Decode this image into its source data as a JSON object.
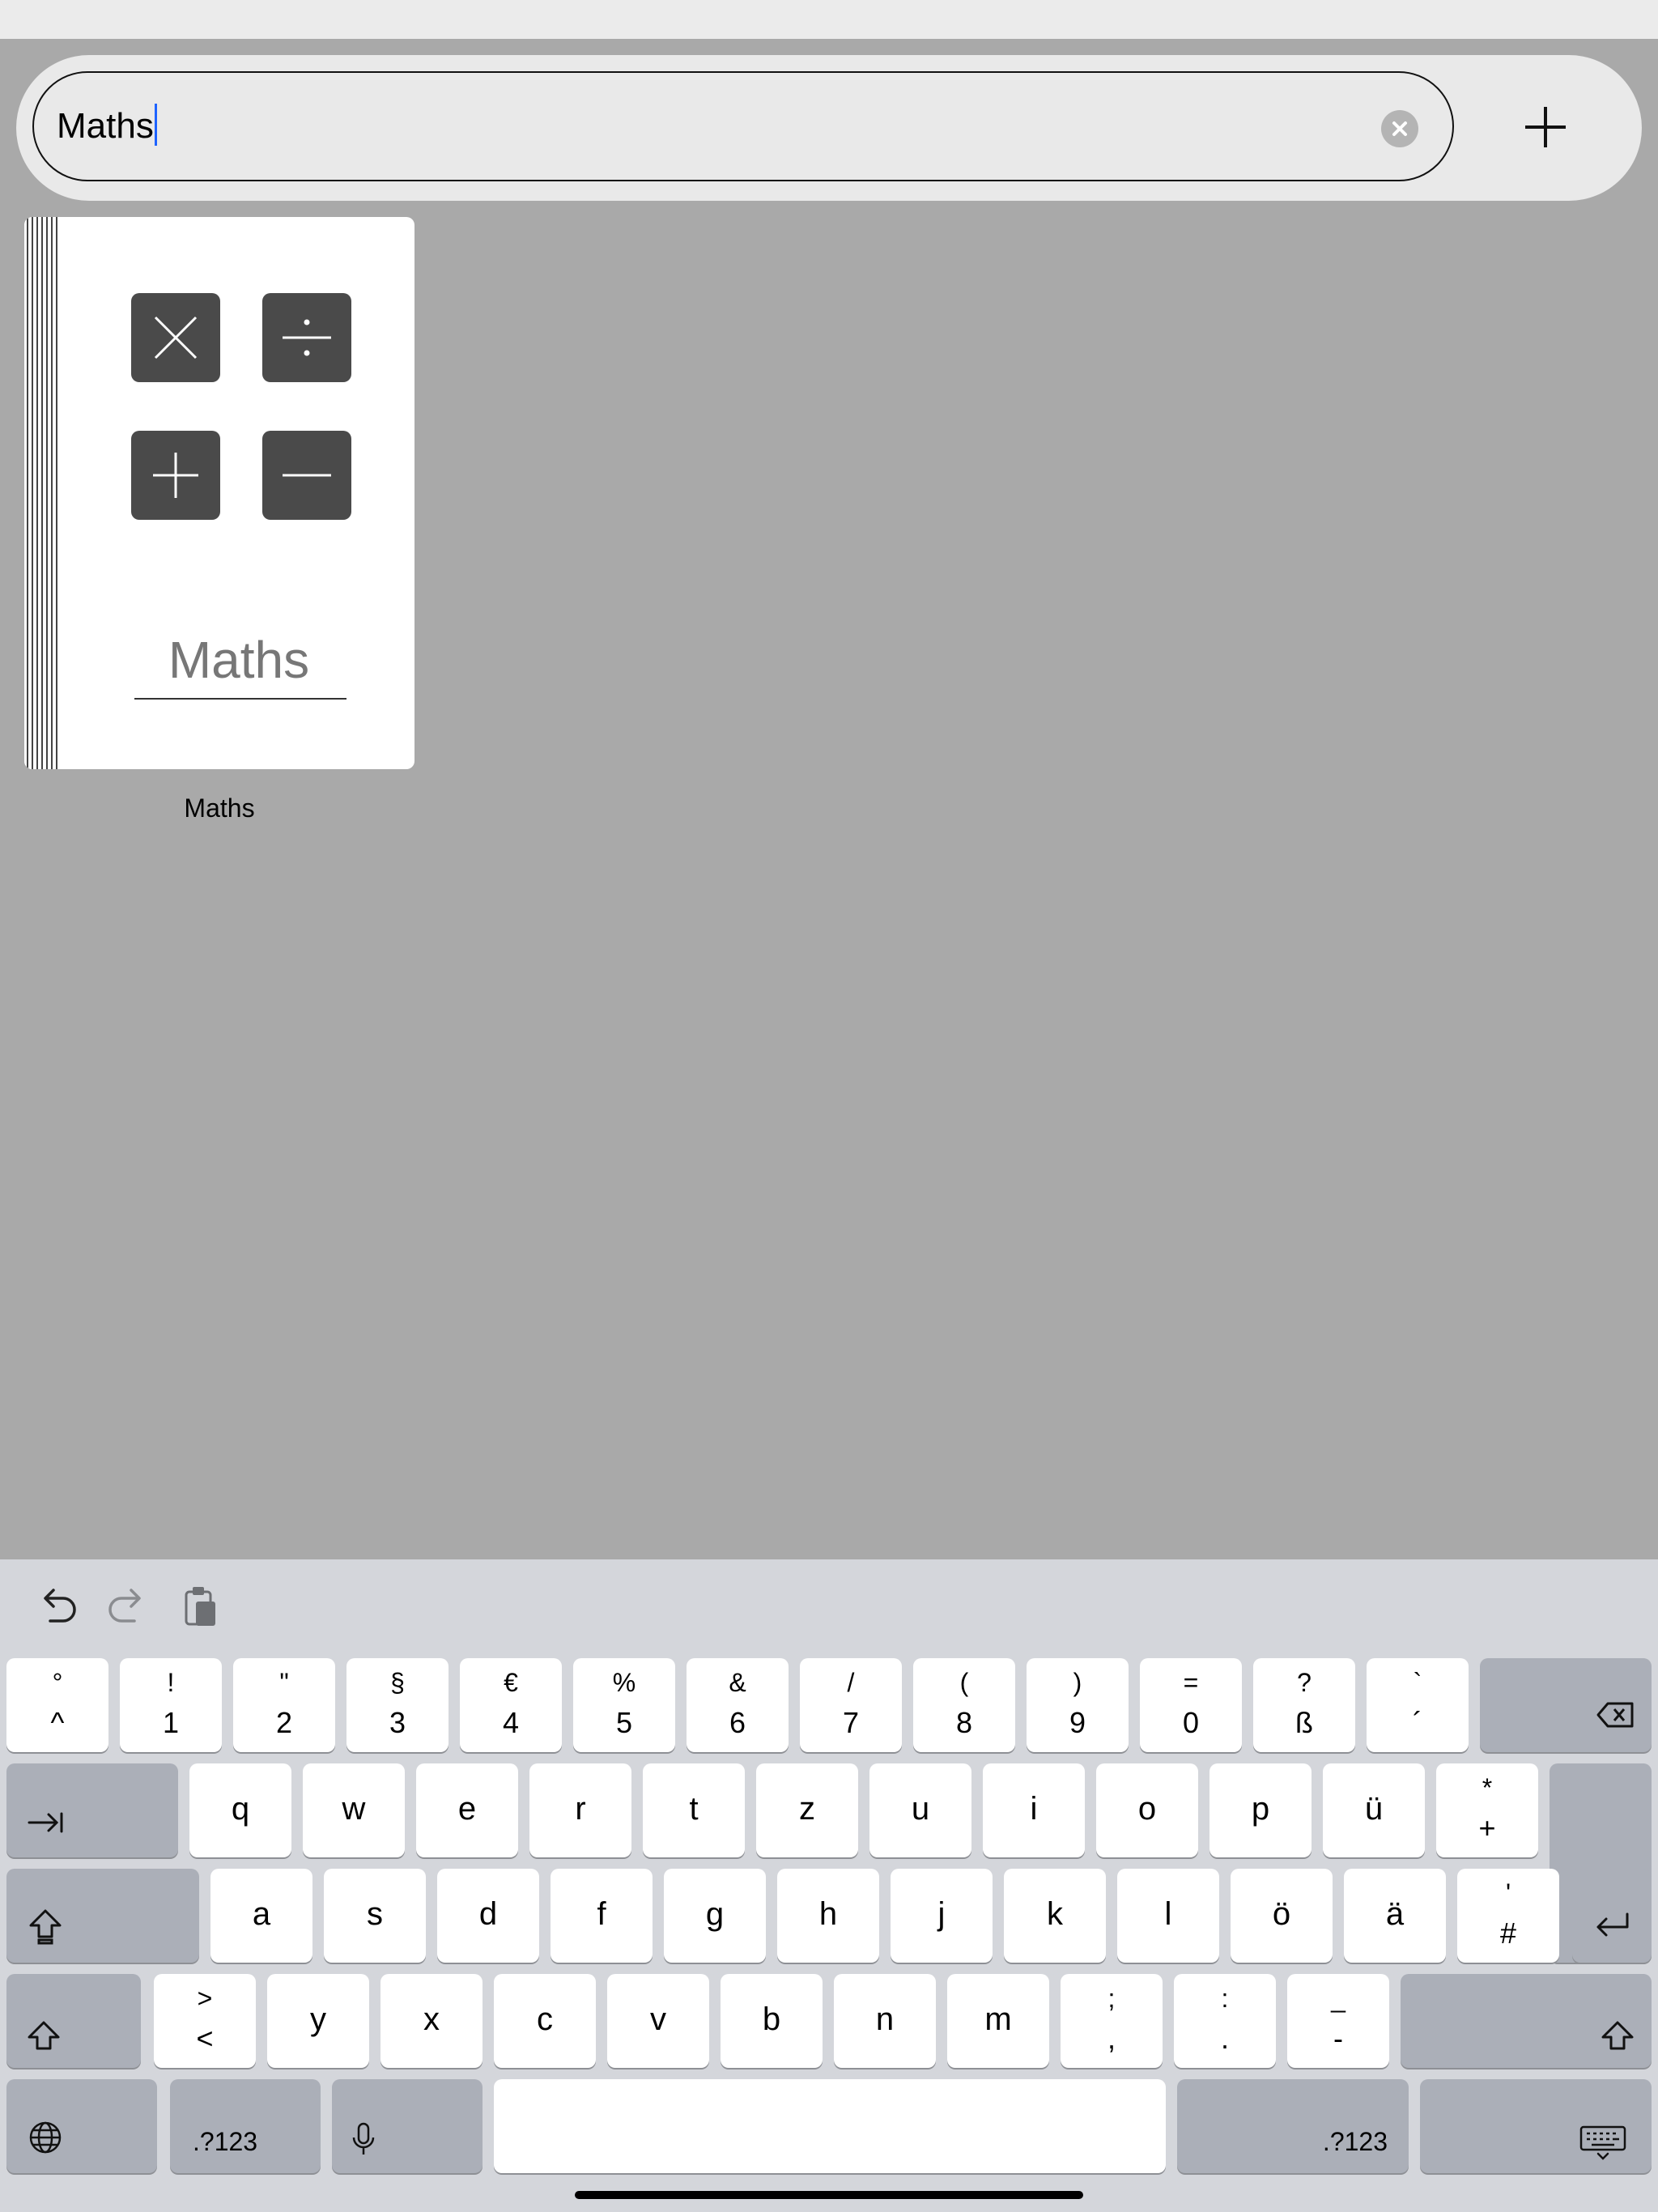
{
  "search": {
    "value": "Maths"
  },
  "notebook": {
    "cover_title": "Maths",
    "label": "Maths"
  },
  "keyboard": {
    "row1": [
      {
        "top": "°",
        "bot": "^"
      },
      {
        "top": "!",
        "bot": "1"
      },
      {
        "top": "\"",
        "bot": "2"
      },
      {
        "top": "§",
        "bot": "3"
      },
      {
        "top": "€",
        "bot": "4"
      },
      {
        "top": "%",
        "bot": "5"
      },
      {
        "top": "&",
        "bot": "6"
      },
      {
        "top": "/",
        "bot": "7"
      },
      {
        "top": "(",
        "bot": "8"
      },
      {
        "top": ")",
        "bot": "9"
      },
      {
        "top": "=",
        "bot": "0"
      },
      {
        "top": "?",
        "bot": "ß"
      },
      {
        "top": "`",
        "bot": "´"
      }
    ],
    "row2": [
      "q",
      "w",
      "e",
      "r",
      "t",
      "z",
      "u",
      "i",
      "o",
      "p",
      "ü"
    ],
    "row2_last": {
      "top": "*",
      "bot": "+"
    },
    "row3": [
      "a",
      "s",
      "d",
      "f",
      "g",
      "h",
      "j",
      "k",
      "l",
      "ö",
      "ä"
    ],
    "row3_last": {
      "top": "'",
      "bot": "#"
    },
    "row4_first": {
      "top": ">",
      "bot": "<"
    },
    "row4": [
      "y",
      "x",
      "c",
      "v",
      "b",
      "n",
      "m"
    ],
    "row4_tail": [
      {
        "top": ";",
        "bot": ","
      },
      {
        "top": ":",
        "bot": "."
      },
      {
        "top": "_",
        "bot": "-"
      }
    ],
    "numbers_label": ".?123"
  },
  "icons": [
    "undo-icon",
    "redo-icon",
    "paste-icon",
    "clear-icon",
    "plus-icon",
    "delete-icon",
    "tab-icon",
    "shift-lock-icon",
    "shift-icon",
    "return-icon",
    "globe-icon",
    "mic-icon",
    "keyboard-hide-icon"
  ]
}
